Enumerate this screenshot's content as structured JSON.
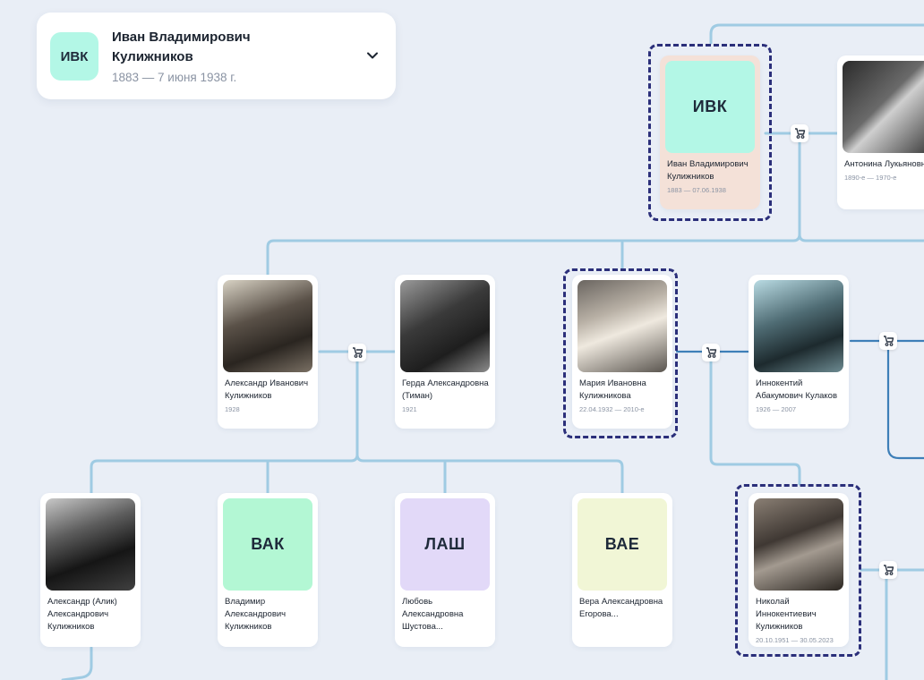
{
  "header": {
    "initials": "ИВК",
    "name_line1": "Иван Владимирович",
    "name_line2": "Кулижников",
    "dates": "1883 — 7 июня 1938 г."
  },
  "persons": {
    "ivan": {
      "initials": "ИВК",
      "name": "Иван Владимирович Кулижников",
      "dates": "1883 — 07.06.1938",
      "thumb_color": "#b3f7e6"
    },
    "antonina": {
      "name": "Антонина Лукьяновна",
      "dates": "1890-е — 1970-е"
    },
    "alexander": {
      "name": "Александр Иванович Кулижников",
      "dates": "1928"
    },
    "gerda": {
      "name": "Герда Александровна (Тиман)",
      "dates": "1921"
    },
    "maria": {
      "name": "Мария Ивановна Кулижникова",
      "dates": "22.04.1932 — 2010-е"
    },
    "innokentiy": {
      "name": "Иннокентий Абакумович Кулаков",
      "dates": "1926 — 2007"
    },
    "alik": {
      "name": "Александр (Алик) Александрович Кулижников",
      "dates": ""
    },
    "vladimir": {
      "initials": "ВАК",
      "name": "Владимир Александрович Кулижников",
      "dates": "",
      "thumb_color": "#b3f7d4"
    },
    "lyubov": {
      "initials": "ЛАШ",
      "name": "Любовь Александровна Шустова...",
      "dates": "",
      "thumb_color": "#e2d9f8"
    },
    "vera": {
      "initials": "ВАЕ",
      "name": "Вера Александровна Егорова...",
      "dates": "",
      "thumb_color": "#f1f6d6"
    },
    "nikolay": {
      "name": "Николай Иннокентиевич Кулижников",
      "dates": "20.10.1951 — 30.05.2023"
    }
  },
  "colors": {
    "background": "#e9eef6",
    "line": "#9fcbe3",
    "line_dark": "#3e7fb8",
    "selection_dash": "#2b2f7a",
    "selected_card": "#f4e1d8"
  },
  "icons": {
    "marriage": "stroller-icon",
    "expand": "chevron-down-icon"
  }
}
